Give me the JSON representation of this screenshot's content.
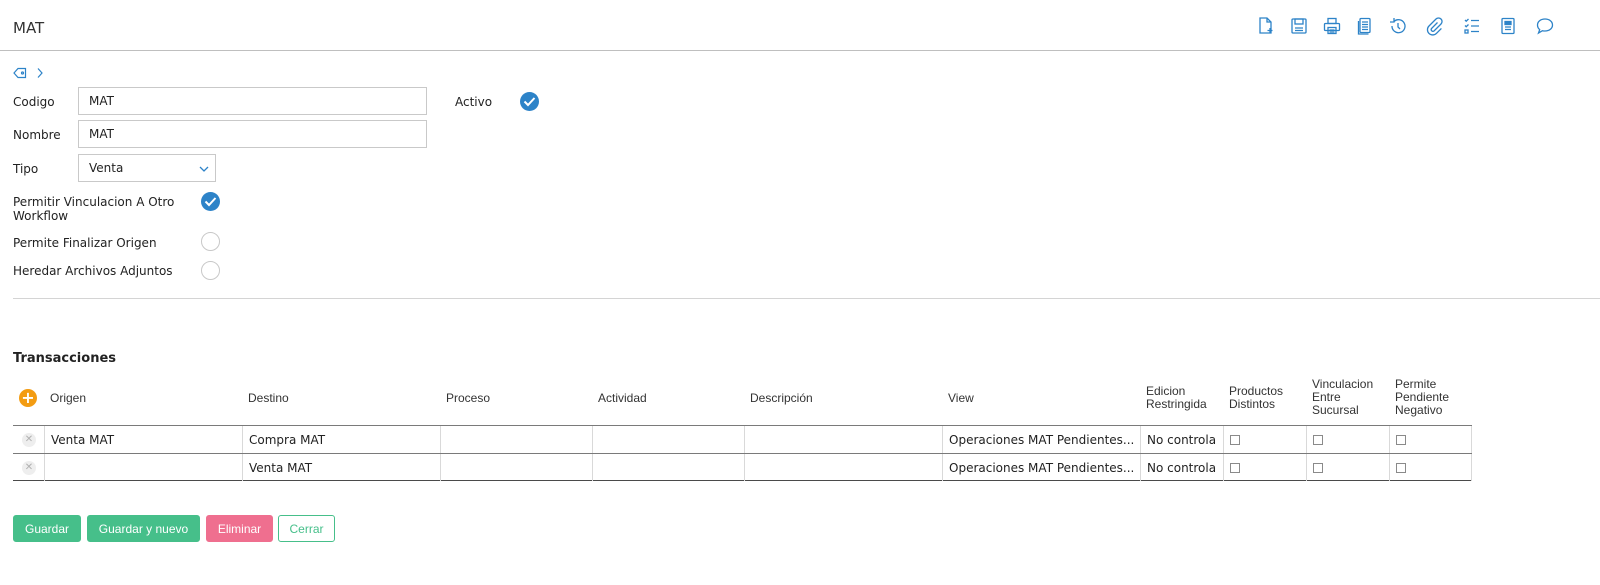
{
  "header": {
    "title": "MAT",
    "toolbar": [
      {
        "name": "new-document-icon",
        "title": "Nuevo"
      },
      {
        "name": "save-icon",
        "title": "Guardar"
      },
      {
        "name": "print-icon",
        "title": "Imprimir"
      },
      {
        "name": "copy-icon",
        "title": "Copiar"
      },
      {
        "name": "history-icon",
        "title": "Historial"
      },
      {
        "name": "attachment-icon",
        "title": "Adjuntos"
      },
      {
        "name": "checklist-icon",
        "title": "Tareas"
      },
      {
        "name": "notes-icon",
        "title": "Notas"
      },
      {
        "name": "comment-icon",
        "title": "Comentarios"
      }
    ],
    "accent": "#2d83c8"
  },
  "form": {
    "codigo_label": "Codigo",
    "codigo_value": "MAT",
    "activo_label": "Activo",
    "activo_checked": true,
    "nombre_label": "Nombre",
    "nombre_value": "MAT",
    "tipo_label": "Tipo",
    "tipo_value": "Venta",
    "permitir_vinculacion_label": "Permitir Vinculacion A Otro Workflow",
    "permitir_vinculacion_checked": true,
    "permite_finalizar_label": "Permite Finalizar Origen",
    "permite_finalizar_checked": false,
    "heredar_archivos_label": "Heredar Archivos Adjuntos",
    "heredar_archivos_checked": false
  },
  "transacciones": {
    "title": "Transacciones",
    "columns": {
      "origen": "Origen",
      "destino": "Destino",
      "proceso": "Proceso",
      "actividad": "Actividad",
      "descripcion": "Descripción",
      "view": "View",
      "edicion": "Edicion Restringida",
      "productos": "Productos Distintos",
      "vinculacion": "Vinculacion Entre Sucursal",
      "permite": "Permite Pendiente Negativo"
    },
    "rows": [
      {
        "origen": "Venta MAT",
        "destino": "Compra MAT",
        "proceso": "",
        "actividad": "",
        "descripcion": "",
        "view": "Operaciones MAT Pendientes...",
        "edicion": "No controla",
        "productos": false,
        "vinculacion": false,
        "permite": false
      },
      {
        "origen": "",
        "destino": "Venta MAT",
        "proceso": "",
        "actividad": "",
        "descripcion": "",
        "view": "Operaciones MAT Pendientes...",
        "edicion": "No controla",
        "productos": false,
        "vinculacion": false,
        "permite": false
      }
    ]
  },
  "buttons": {
    "guardar": "Guardar",
    "guardar_nuevo": "Guardar y nuevo",
    "eliminar": "Eliminar",
    "cerrar": "Cerrar"
  }
}
